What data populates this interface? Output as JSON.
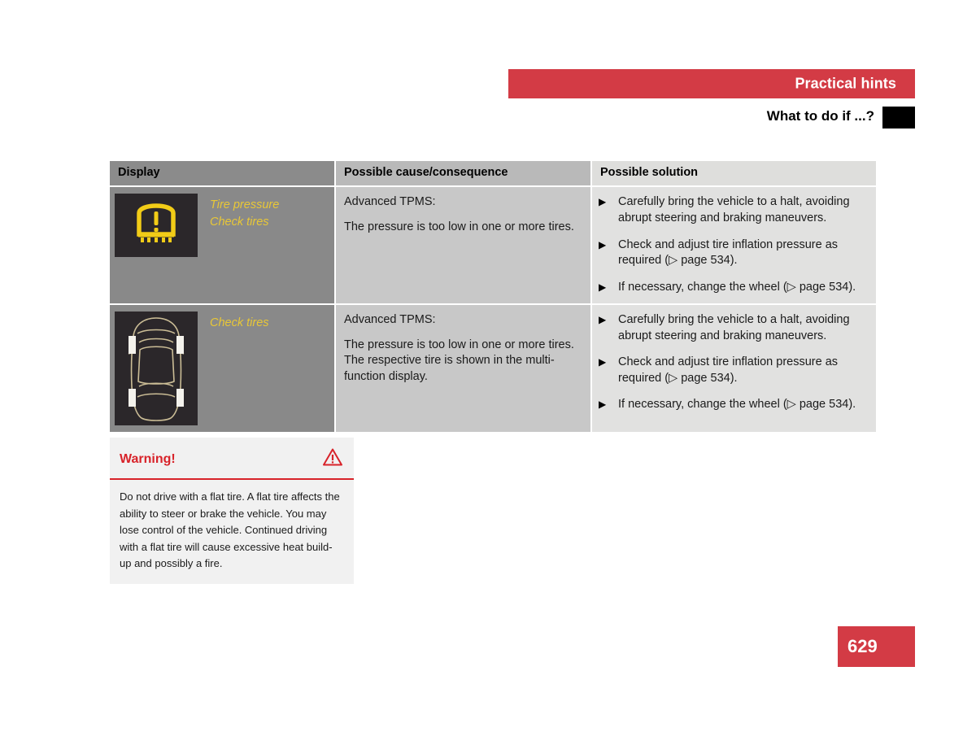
{
  "header": {
    "section_title": "Practical hints",
    "subtitle": "What to do if ...?"
  },
  "table": {
    "columns": [
      "Display",
      "Possible cause/consequence",
      "Possible solution"
    ],
    "rows": [
      {
        "display": {
          "icon": "tpms-warning-icon",
          "labels": [
            "Tire pressure",
            "Check tires"
          ]
        },
        "cause": {
          "lead": "Advanced TPMS:",
          "body": "The pressure is too low in one or more tires."
        },
        "solutions": [
          "Carefully bring the vehicle to a halt, avoiding abrupt steering and braking maneuvers.",
          "Check and adjust tire inflation pressure as required (▷ page 534).",
          "If necessary, change the wheel (▷ page 534)."
        ]
      },
      {
        "display": {
          "icon": "car-top-view-tires-icon",
          "labels": [
            "Check tires"
          ]
        },
        "cause": {
          "lead": "Advanced TPMS:",
          "body": "The pressure is too low in one or more tires. The respective tire is shown in the multi-function display."
        },
        "solutions": [
          "Carefully bring the vehicle to a halt, avoiding abrupt steering and braking maneuvers.",
          "Check and adjust tire inflation pressure as required (▷ page 534).",
          "If necessary, change the wheel (▷ page 534)."
        ]
      }
    ]
  },
  "warning": {
    "title": "Warning!",
    "icon": "warning-triangle-icon",
    "body": "Do not drive with a flat tire. A flat tire affects the ability to steer or brake the vehicle. You may lose control of the vehicle. Continued driving with a flat tire will cause excessive heat build-up and possibly a fire."
  },
  "page_number": "629",
  "colors": {
    "brand_red": "#d33b45",
    "warning_red": "#d8232a",
    "icon_yellow": "#e8c737",
    "panel_dark": "#2b272a"
  }
}
